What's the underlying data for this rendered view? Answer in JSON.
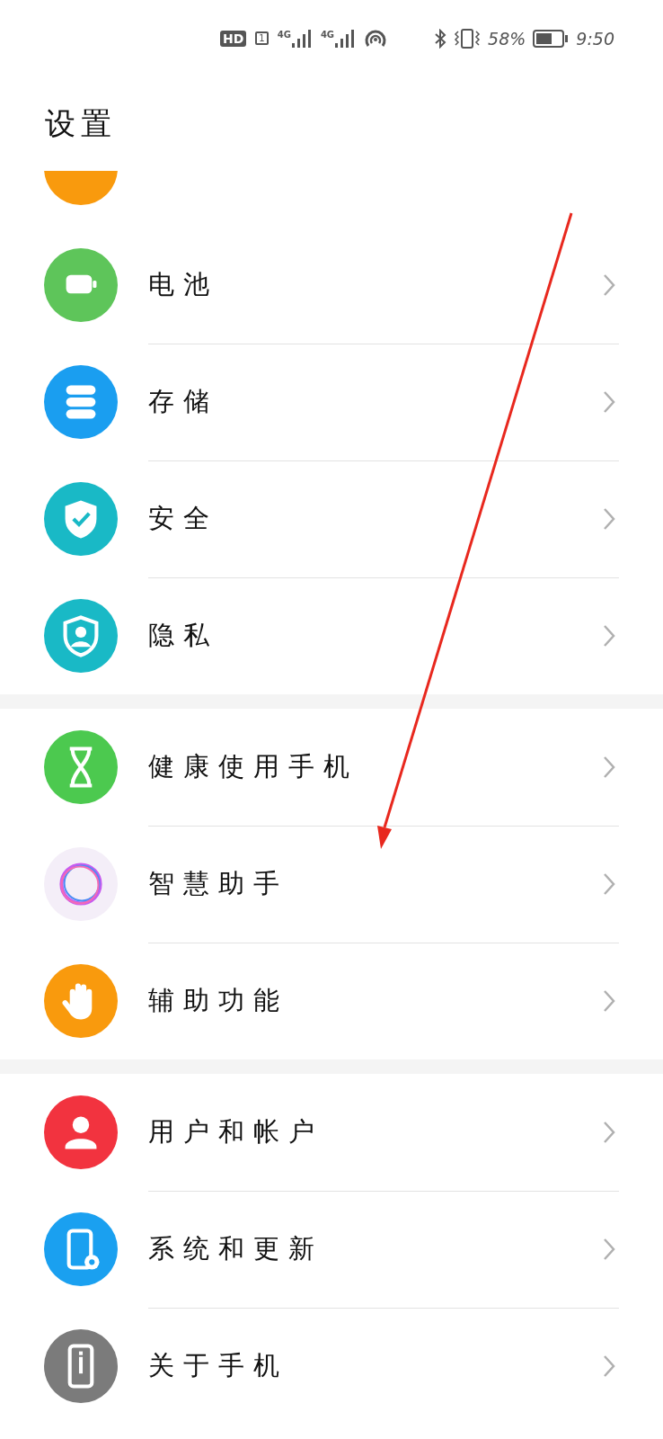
{
  "status_bar": {
    "hd": "HD",
    "sim": "1",
    "network_1": "4G",
    "network_2": "4G",
    "battery_percent": "58%",
    "time": "9:50"
  },
  "title": "设置",
  "groups": [
    {
      "rows": [
        {
          "label": "电池",
          "color": "#5ec55a"
        },
        {
          "label": "存储",
          "color": "#1a9ef0"
        },
        {
          "label": "安全",
          "color": "#19b9c6"
        },
        {
          "label": "隐私",
          "color": "#19b9c6"
        }
      ]
    },
    {
      "rows": [
        {
          "label": "健康使用手机",
          "color": "#4cc94f"
        },
        {
          "label": "智慧助手",
          "color": "#f4eef8"
        },
        {
          "label": "辅助功能",
          "color": "#f99a0d"
        }
      ]
    },
    {
      "rows": [
        {
          "label": "用户和帐户",
          "color": "#f2333f"
        },
        {
          "label": "系统和更新",
          "color": "#1aa0f0"
        },
        {
          "label": "关于手机",
          "color": "#7b7b7b"
        }
      ]
    }
  ]
}
